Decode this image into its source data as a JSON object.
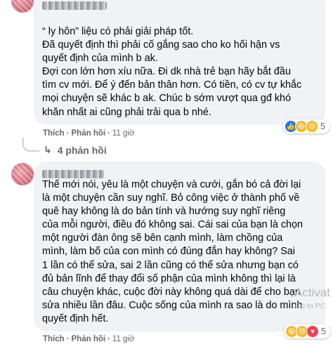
{
  "comment1": {
    "lines": [
      "“ ly hôn” liệu có phải giải pháp tốt.",
      "Đã quyết định thì phải cố gắng sao cho ko hối hận vs",
      "quyết định của mình b ak.",
      "Đợi con lớn hơn xíu nữa. Đi dk nhà trẻ bạn hãy bắt đầu",
      "tìm cv mới. Để ý đến bản thân hơn. Có tiền, có cv tự khắc",
      "mọi chuyện sẽ khác b ak. Chúc b sớm vượt qua gđ khó",
      "khăn nhất ai cũng phải trải qua b nhé."
    ],
    "actions": {
      "like": "Thích",
      "reply": "Phản hồi",
      "time": "11 giờ"
    },
    "reactions": {
      "icons": [
        "like-icon",
        "haha-icon",
        "sad-icon"
      ],
      "count": "5"
    },
    "replies_label": "4 phản hồi"
  },
  "comment2": {
    "lines": [
      "Thế mới nói, yêu là một chuyện và cưới, gắn bó cả đời lại",
      "là một chuyện cần suy nghĩ. Bỏ công việc ở thành phố về",
      "quê hay không là do bản tính và hướng suy nghĩ riêng",
      "của mỗi người, điều đó không sai. Cái sai của bạn là chọn",
      "một người đàn ông sẽ bên cạnh mình, làm chồng của",
      "mình, làm bố của con mình có đúng đắn hay không? Sai",
      "1 lần có thể sửa, sai 2 lần cũng có thể sửa nhưng bạn có",
      "đủ bản lĩnh để thay đổi số phận của mình không thì lại là",
      "câu chuyện khác, cuộc đời này không quá dài để cho bạn",
      "sửa nhiều lần đâu. Cuộc sống của mình ra sao là do mình",
      "quyết định hết."
    ],
    "actions": {
      "like": "Thích",
      "reply": "Phản hồi",
      "time": "11 giờ"
    },
    "reactions": {
      "icons": [
        "haha-icon",
        "sad-icon",
        "love-icon"
      ],
      "count": "5"
    }
  },
  "watermark": {
    "line1": "Activat",
    "line2": "Go to PC"
  },
  "colors": {
    "bubble": "#f0f2f5",
    "meta": "#65676b",
    "like": "#1877f2",
    "love": "#f33e58",
    "haha": "#f7b928"
  }
}
